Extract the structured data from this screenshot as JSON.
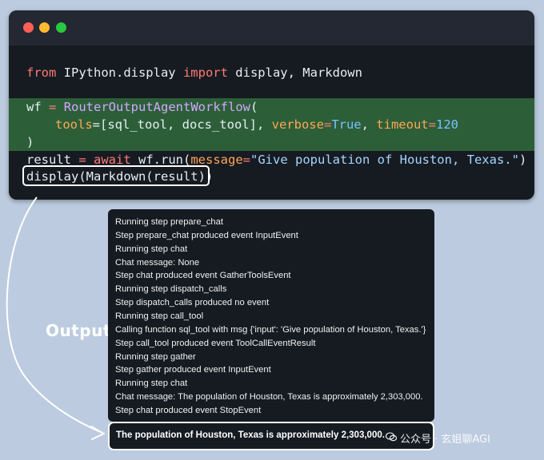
{
  "editor": {
    "window_controls": [
      "close",
      "minimize",
      "maximize"
    ],
    "code": {
      "line1": {
        "kw1": "from",
        "mod": " IPython.display ",
        "kw2": "import",
        "rest": " display, Markdown"
      },
      "line2": {
        "a": "wf ",
        "op": "=",
        "b": " ",
        "fn": "RouterOutputAgentWorkflow",
        "c": "("
      },
      "line3": {
        "p1": "tools",
        "eq1": "=[sql_tool, docs_tool], ",
        "p2": "verbose",
        "eq2": "=",
        "v2": "True",
        "sep": ", ",
        "p3": "timeout",
        "eq3": "=",
        "v3": "120"
      },
      "line4": {
        "a": ")"
      },
      "line5": {
        "a": "result ",
        "op": "=",
        "b": " ",
        "kw": "await",
        "c": " wf.run(",
        "p": "message",
        "eq": "=",
        "str": "\"Give population of Houston, Texas.\"",
        "d": ")"
      },
      "line6": {
        "a": "display(Markdown(result))"
      }
    }
  },
  "output": {
    "label": "Output",
    "lines": [
      "Running step prepare_chat",
      "Step prepare_chat produced event InputEvent",
      "Running step chat",
      "Chat message: None",
      "Step chat produced event GatherToolsEvent",
      "Running step dispatch_calls",
      "Step dispatch_calls produced no event",
      "Running step call_tool",
      "Calling function sql_tool with msg {'input': 'Give population of Houston, Texas.'}",
      "Step call_tool produced event ToolCallEventResult",
      "Running step gather",
      "Step gather produced event InputEvent",
      "Running step chat",
      "Chat message: The population of Houston, Texas is approximately 2,303,000.",
      "Step chat produced event StopEvent"
    ],
    "result": "The population of Houston, Texas is approximately 2,303,000."
  },
  "watermark": {
    "icon": "wechat-icon",
    "text": "公众号 · 玄姐聊AGI"
  },
  "colors": {
    "background": "#bccbdf",
    "editor_bg": "#161b22",
    "highlight": "#2c5f38",
    "keyword": "#ff7b72",
    "function": "#d2a8ff",
    "param": "#ffa657",
    "string": "#a5d6ff"
  }
}
